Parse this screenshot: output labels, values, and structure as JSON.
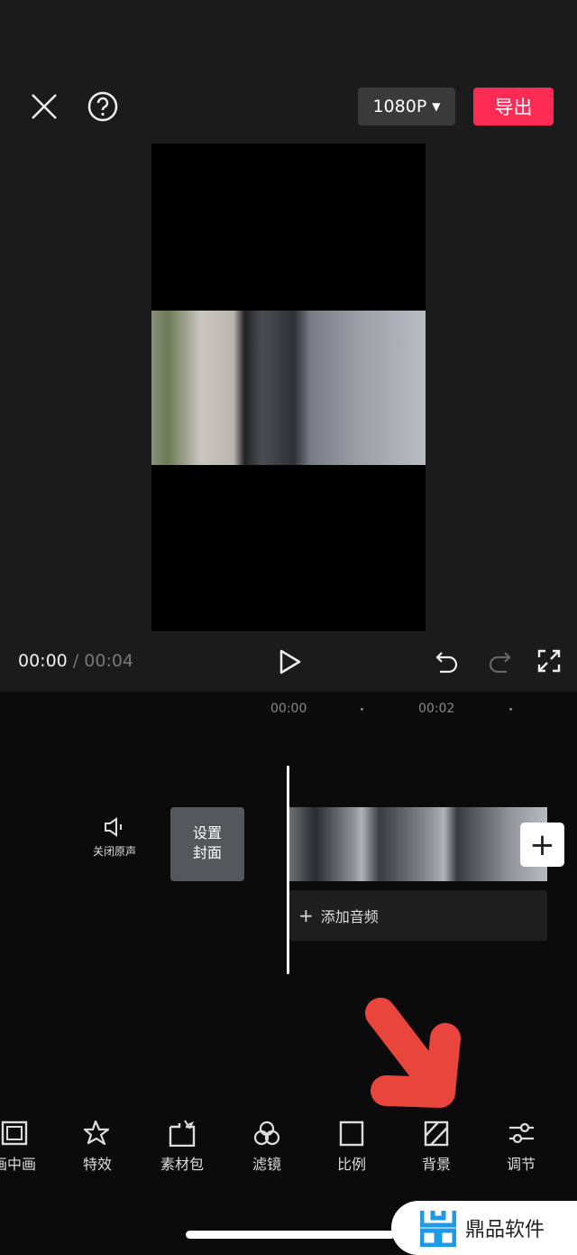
{
  "header": {
    "resolution": "1080P",
    "export_label": "导出"
  },
  "player": {
    "current_time": "00:00",
    "separator": "/",
    "total_time": "00:04"
  },
  "timeline": {
    "ticks": [
      "00:00",
      "00:02"
    ],
    "mute_label": "关闭原声",
    "cover_label_1": "设置",
    "cover_label_2": "封面",
    "add_audio_label": "添加音频",
    "add_clip": "+"
  },
  "toolbar": {
    "items": [
      {
        "label": "画中画",
        "icon": "picture-in-picture-icon"
      },
      {
        "label": "特效",
        "icon": "effects-star-icon"
      },
      {
        "label": "素材包",
        "icon": "material-pack-icon"
      },
      {
        "label": "滤镜",
        "icon": "filter-icon"
      },
      {
        "label": "比例",
        "icon": "ratio-icon"
      },
      {
        "label": "背景",
        "icon": "background-icon"
      },
      {
        "label": "调节",
        "icon": "adjust-icon"
      }
    ]
  },
  "watermark": {
    "text": "鼎品软件"
  },
  "colors": {
    "accent": "#fe2c55",
    "annotation_arrow": "#e8453c",
    "watermark_blue": "#1e9be8"
  }
}
